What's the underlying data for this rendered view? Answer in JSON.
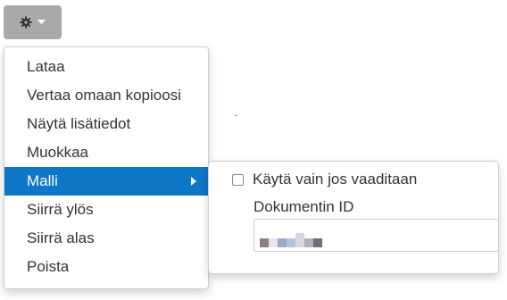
{
  "toolbar": {
    "gear_icon": "gear-icon",
    "caret_icon": "caret-down-icon"
  },
  "menu": {
    "items": [
      {
        "label": "Lataa"
      },
      {
        "label": "Vertaa omaan kopioosi"
      },
      {
        "label": "Näytä lisätiedot"
      },
      {
        "label": "Muokkaa"
      },
      {
        "label": "Malli",
        "active": true,
        "has_submenu": true
      },
      {
        "label": "Siirrä ylös"
      },
      {
        "label": "Siirrä alas"
      },
      {
        "label": "Poista"
      }
    ]
  },
  "submenu": {
    "checkbox_label": "Käytä vain jos vaaditaan",
    "checkbox_checked": false,
    "document_id_label": "Dokumentin ID"
  },
  "colors": {
    "accent": "#0f77c8",
    "button_bg": "#a9a9a9",
    "text": "#333333"
  }
}
